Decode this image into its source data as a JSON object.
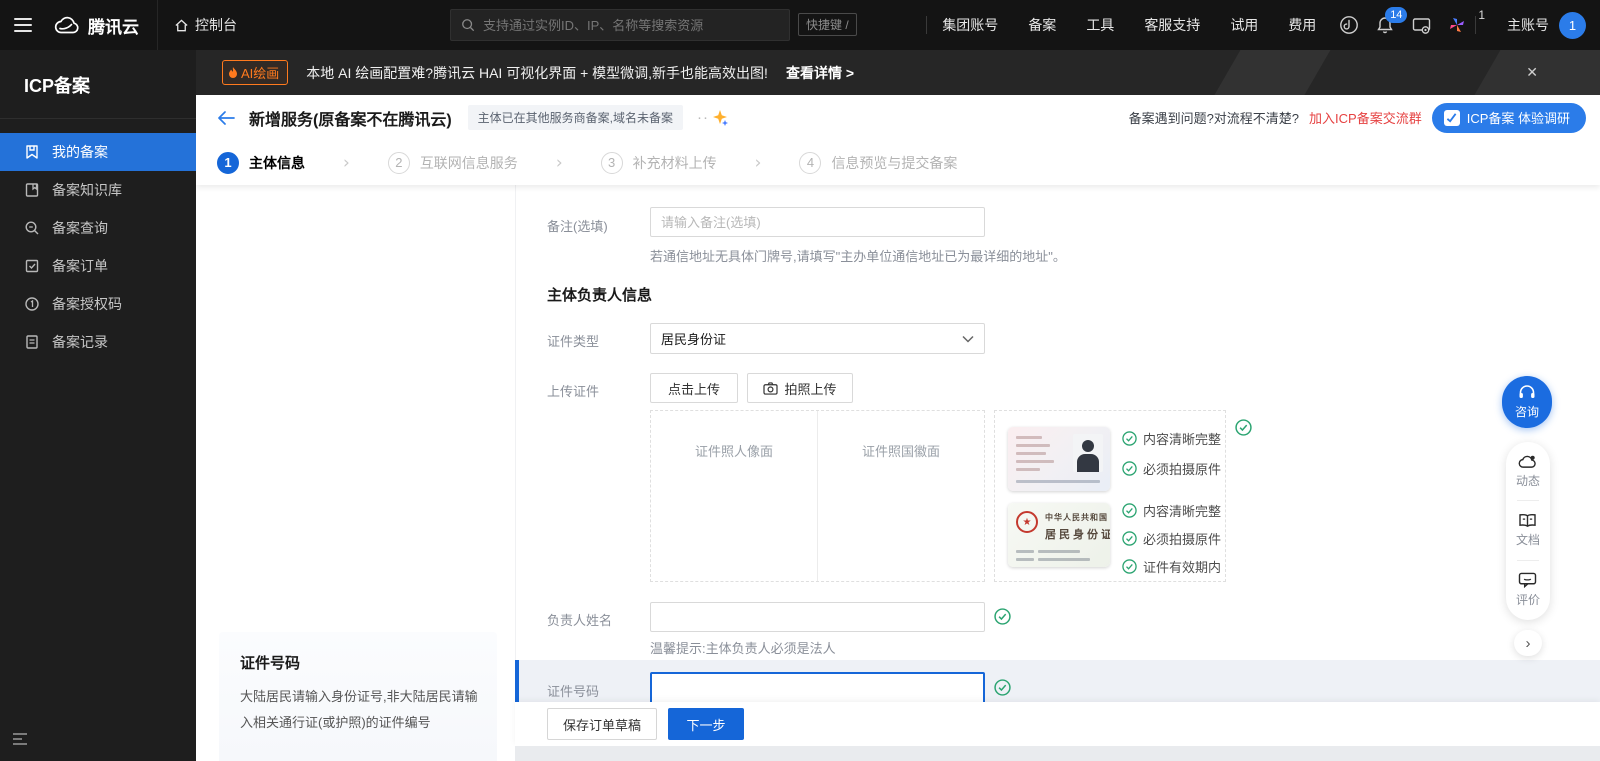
{
  "colors": {
    "primary": "#1566d8",
    "bright_blue": "#2b7ce9",
    "green": "#2ba471",
    "link_red": "#e64242",
    "badge_orange": "#ff7a1e"
  },
  "topnav": {
    "brand": "腾讯云",
    "console": "控制台",
    "search_placeholder": "支持通过实例ID、IP、名称等搜索资源",
    "shortcut": "快捷键 /",
    "items": [
      "集团账号",
      "备案",
      "工具",
      "客服支持",
      "试用",
      "费用"
    ],
    "bell_badge": "14",
    "beta_count": "1",
    "account_label": "主账号",
    "avatar_text": "1"
  },
  "sidebar": {
    "title": "ICP备案",
    "items": [
      {
        "label": "我的备案"
      },
      {
        "label": "备案知识库"
      },
      {
        "label": "备案查询"
      },
      {
        "label": "备案订单"
      },
      {
        "label": "备案授权码"
      },
      {
        "label": "备案记录"
      }
    ]
  },
  "banner": {
    "badge": "AI绘画",
    "text": "本地 AI 绘画配置难?腾讯云 HAI 可视化界面 + 模型微调,新手也能高效出图!",
    "link": "查看详情 >",
    "close": "✕"
  },
  "header": {
    "title": "新增服务(原备案不在腾讯云)",
    "tag": "主体已在其他服务商备案,域名未备案",
    "dots": "··",
    "question": "备案遇到问题?对流程不清楚?",
    "link": "加入ICP备案交流群",
    "survey": "ICP备案 体验调研"
  },
  "steps": [
    {
      "num": "1",
      "label": "主体信息"
    },
    {
      "num": "2",
      "label": "互联网信息服务"
    },
    {
      "num": "3",
      "label": "补充材料上传"
    },
    {
      "num": "4",
      "label": "信息预览与提交备案"
    }
  ],
  "form": {
    "remark": {
      "label": "备注(选填)",
      "placeholder": "请输入备注(选填)",
      "hint": "若通信地址无具体门牌号,请填写\"主办单位通信地址已为最详细的地址\"。"
    },
    "section_title": "主体负责人信息",
    "cert_type": {
      "label": "证件类型",
      "value": "居民身份证"
    },
    "upload": {
      "label": "上传证件",
      "click_btn": "点击上传",
      "photo_btn": "拍照上传",
      "front_placeholder": "证件照人像面",
      "back_placeholder": "证件照国徽面",
      "front_checks": [
        "内容清晰完整",
        "必须拍摄原件"
      ],
      "back_checks": [
        "内容清晰完整",
        "必须拍摄原件",
        "证件有效期内"
      ],
      "card_back_line1": "中华人民共和国",
      "card_back_line2": "居民身份证"
    },
    "name": {
      "label": "负责人姓名",
      "hint": "温馨提示:主体负责人必须是法人"
    },
    "cert_no": {
      "label": "证件号码"
    }
  },
  "help_panel": {
    "title": "证件号码",
    "body": "大陆居民请输入身份证号,非大陆居民请输入相关通行证(或护照)的证件编号"
  },
  "footer": {
    "save_draft": "保存订单草稿",
    "next": "下一步"
  },
  "float_bar": {
    "consult": "咨询",
    "items": [
      {
        "label": "动态"
      },
      {
        "label": "文档"
      },
      {
        "label": "评价"
      }
    ]
  }
}
